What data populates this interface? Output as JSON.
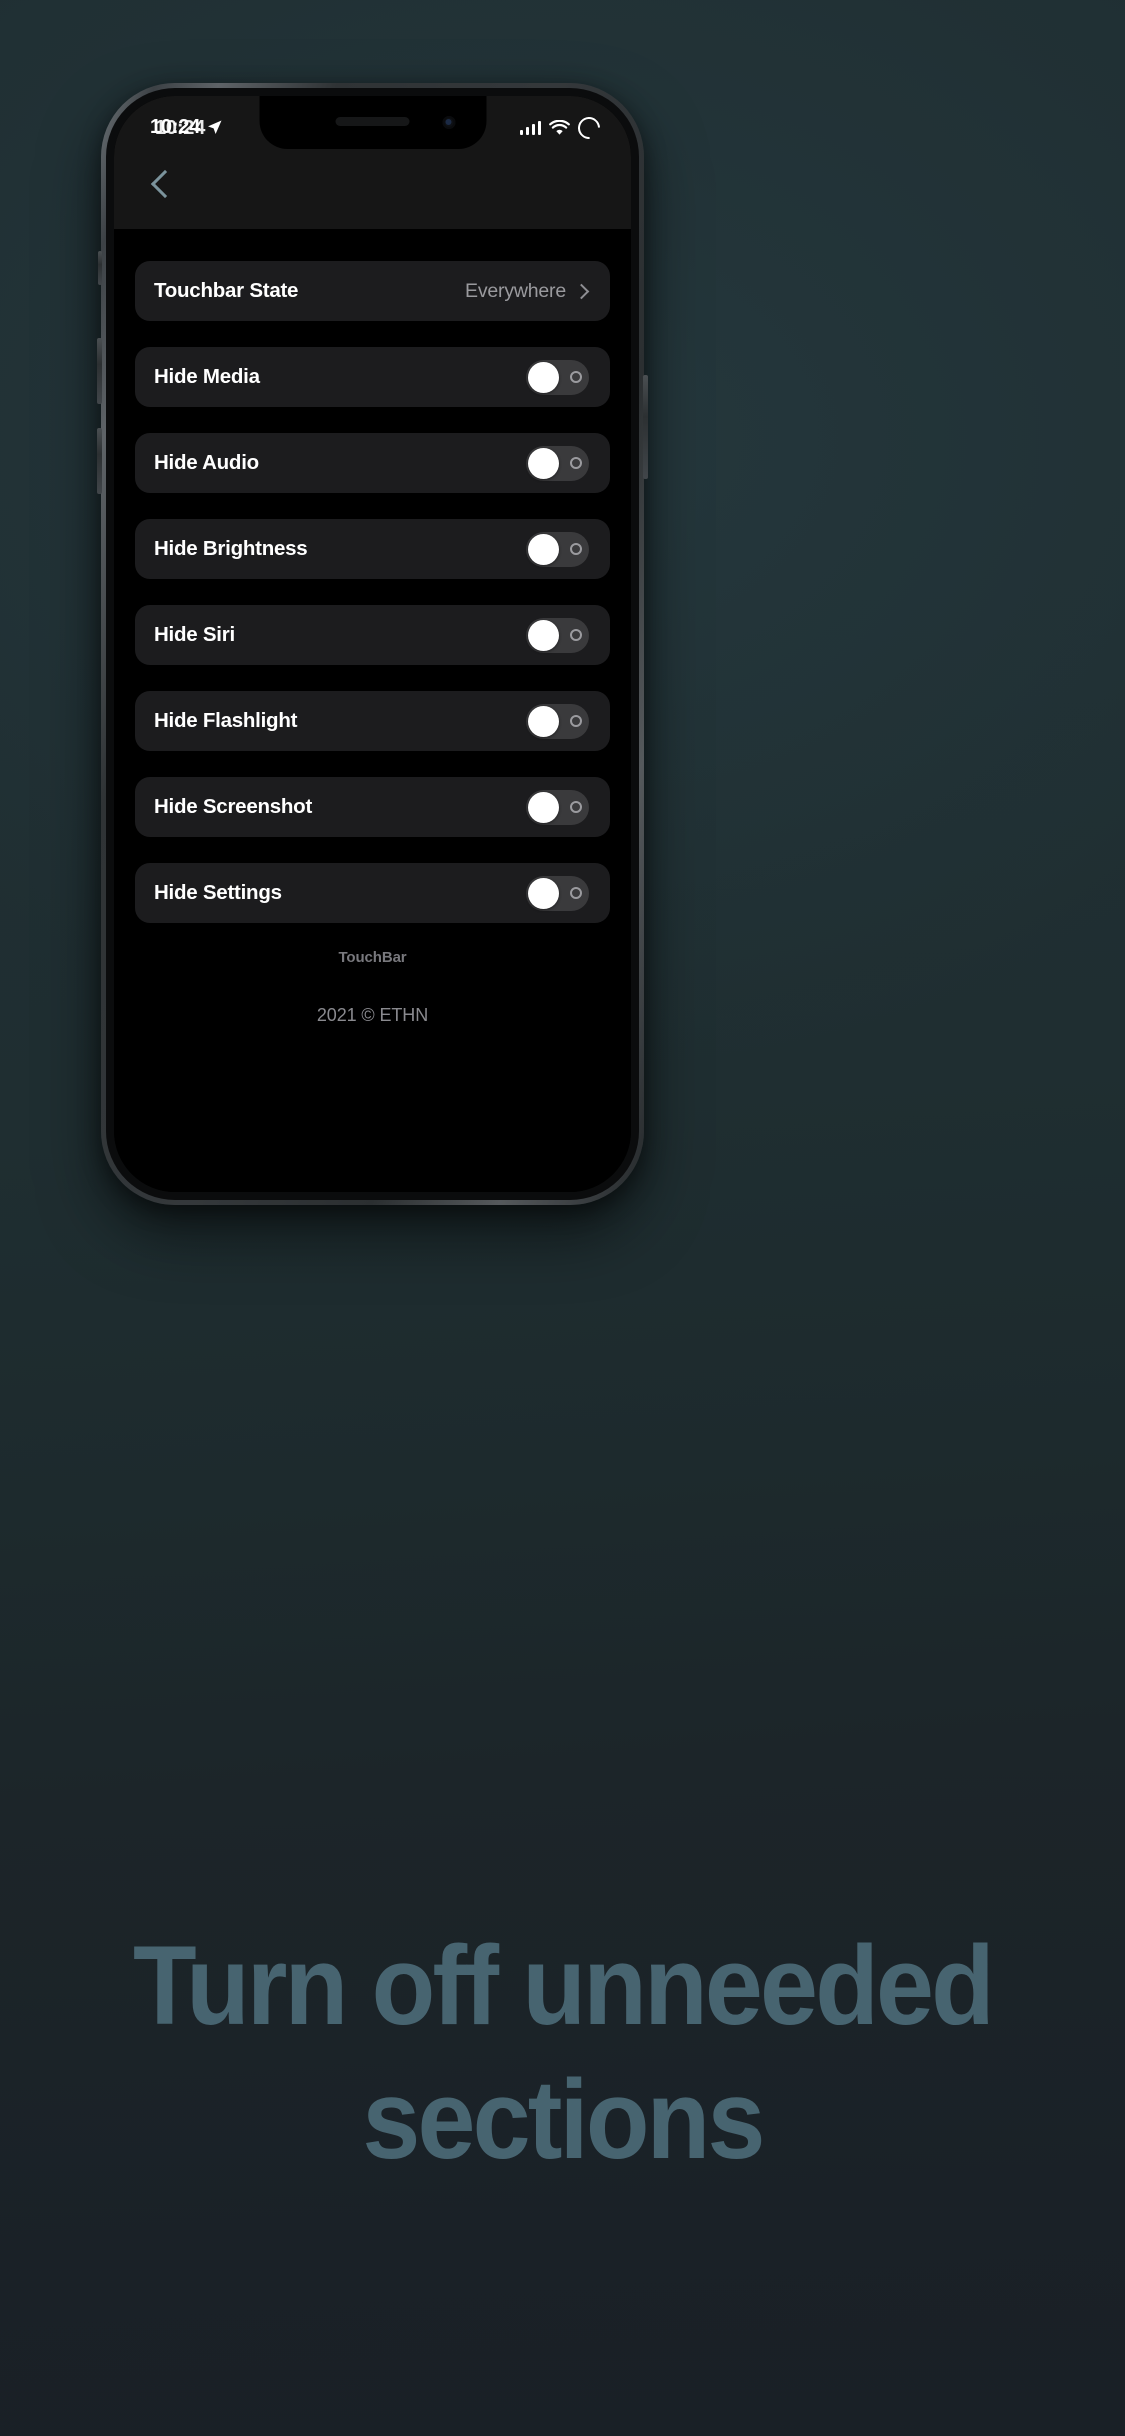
{
  "caption": {
    "line1": "Turn off unneeded",
    "line2": "sections",
    "color": "#476470"
  },
  "background": {
    "top_color": "#202f33",
    "bottom_color": "#192026"
  },
  "device": {
    "frame_color": "#34383b",
    "screen_background": "#000000"
  },
  "statusbar": {
    "time": "10:24",
    "time_ghost": "10:24",
    "location_icon": "location-arrow-icon",
    "signal_icon": "cellular-bars-icon",
    "wifi_icon": "wifi-icon",
    "battery_icon": "battery-ring-icon"
  },
  "navbar": {
    "back_icon": "chevron-left-icon",
    "background": "#161616",
    "back_color": "#7b939c"
  },
  "list": {
    "row_background": "#1c1c1e",
    "items": [
      {
        "name": "touchbar-state",
        "label": "Touchbar State",
        "type": "disclosure",
        "value": "Everywhere",
        "chevron": "chevron-right-icon"
      },
      {
        "name": "hide-media",
        "label": "Hide Media",
        "type": "toggle",
        "state": "off"
      },
      {
        "name": "hide-audio",
        "label": "Hide Audio",
        "type": "toggle",
        "state": "off"
      },
      {
        "name": "hide-brightness",
        "label": "Hide Brightness",
        "type": "toggle",
        "state": "off"
      },
      {
        "name": "hide-siri",
        "label": "Hide Siri",
        "type": "toggle",
        "state": "off"
      },
      {
        "name": "hide-flashlight",
        "label": "Hide Flashlight",
        "type": "toggle",
        "state": "off"
      },
      {
        "name": "hide-screenshot",
        "label": "Hide Screenshot",
        "type": "toggle",
        "state": "off"
      },
      {
        "name": "hide-settings",
        "label": "Hide Settings",
        "type": "toggle",
        "state": "off"
      }
    ]
  },
  "footer": {
    "brand": "TouchBar",
    "copyright": "2021 © ETHN"
  }
}
